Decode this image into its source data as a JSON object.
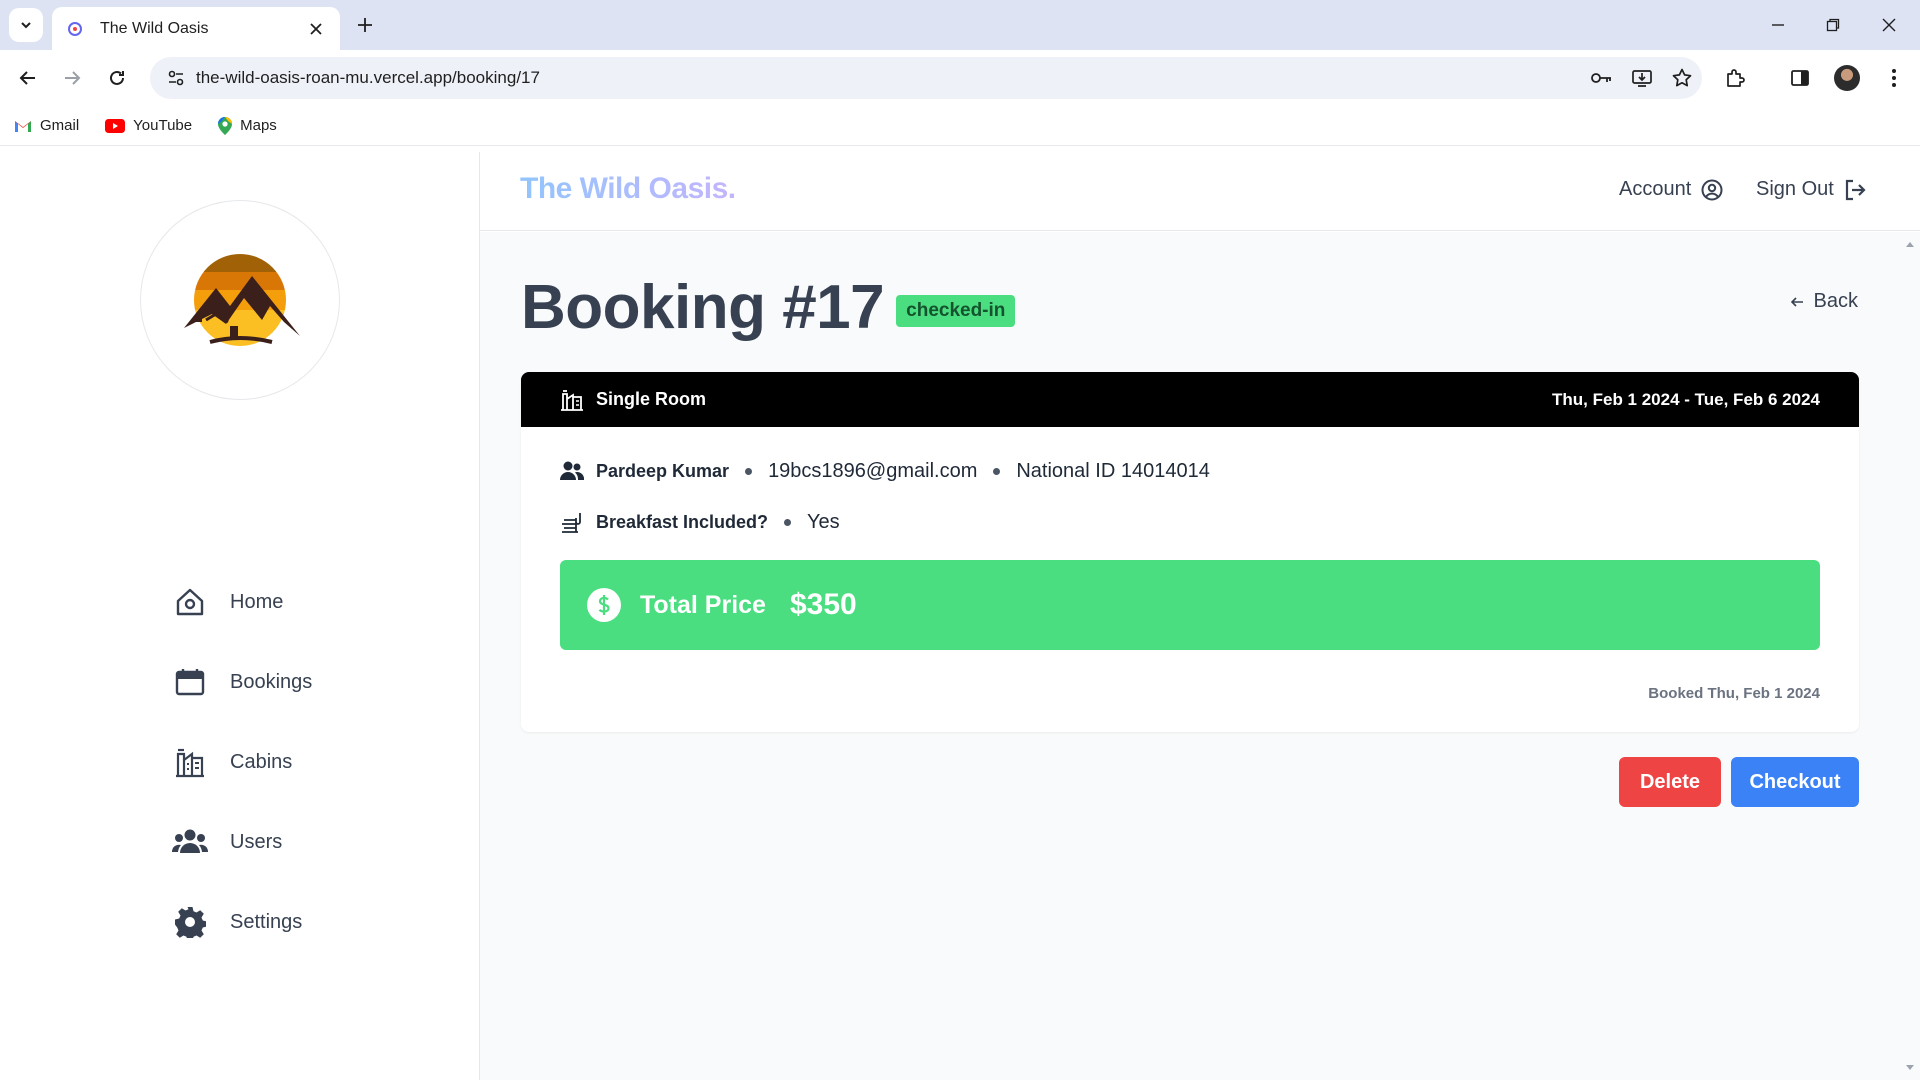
{
  "browser": {
    "tab_title": "The Wild Oasis",
    "url": "the-wild-oasis-roan-mu.vercel.app/booking/17",
    "bookmarks": [
      {
        "label": "Gmail"
      },
      {
        "label": "YouTube"
      },
      {
        "label": "Maps"
      }
    ]
  },
  "sidebar": {
    "nav": [
      {
        "label": "Home",
        "icon": "home-icon"
      },
      {
        "label": "Bookings",
        "icon": "calendar-icon"
      },
      {
        "label": "Cabins",
        "icon": "building-icon"
      },
      {
        "label": "Users",
        "icon": "users-icon"
      },
      {
        "label": "Settings",
        "icon": "gear-icon"
      }
    ]
  },
  "header": {
    "brand": "The Wild Oasis.",
    "account_label": "Account",
    "signout_label": "Sign Out"
  },
  "booking": {
    "title": "Booking #17",
    "status": "checked-in",
    "back_label": "Back",
    "room": "Single Room",
    "dates": "Thu, Feb 1 2024 - Tue, Feb 6 2024",
    "guest_name": "Pardeep Kumar",
    "guest_email": "19bcs1896@gmail.com",
    "national_id": "National ID 14014014",
    "breakfast_label": "Breakfast Included?",
    "breakfast_value": "Yes",
    "price_label": "Total Price",
    "price_value": "$350",
    "booked_on": "Booked Thu, Feb 1 2024"
  },
  "actions": {
    "delete_label": "Delete",
    "checkout_label": "Checkout"
  },
  "colors": {
    "status_badge": "#4ade80",
    "price_box": "#4ade80",
    "delete": "#ef4444",
    "checkout": "#3b82f6"
  }
}
